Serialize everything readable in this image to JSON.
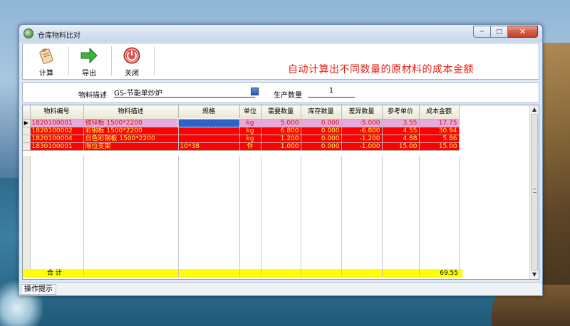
{
  "window": {
    "title": "仓库物料比对"
  },
  "toolbar": {
    "calculate_label": "计算",
    "export_label": "导出",
    "close_label": "关闭",
    "headline": "自动计算出不同数量的原材料的成本金额"
  },
  "form": {
    "material_desc_label": "物料描述",
    "material_desc_value": "GS-节能单炒炉",
    "quantity_label": "生产数量",
    "quantity_value": "1"
  },
  "grid": {
    "columns": [
      "物料编号",
      "物料描述",
      "规格",
      "单位",
      "需要数量",
      "库存数量",
      "差异数量",
      "参考单价",
      "成本金额"
    ],
    "rows": [
      {
        "code": "1820100001",
        "desc": "镀锌板 1500*2200",
        "spec": "",
        "unit": "kg",
        "need": "5.000",
        "stock": "0.000",
        "diff": "-5.000",
        "price": "3.55",
        "amount": "17.75"
      },
      {
        "code": "1820100002",
        "desc": "彩钢板 1500*2200",
        "spec": "",
        "unit": "kg",
        "need": "6.800",
        "stock": "0.000",
        "diff": "-6.800",
        "price": "4.55",
        "amount": "30.94"
      },
      {
        "code": "1820100004",
        "desc": "白色彩钢板 1500*2200",
        "spec": "",
        "unit": "kg",
        "need": "1.200",
        "stock": "0.000",
        "diff": "-1.200",
        "price": "4.88",
        "amount": "5.86"
      },
      {
        "code": "1830100001",
        "desc": "限位支架",
        "spec": "10*38",
        "unit": "件",
        "need": "1.000",
        "stock": "0.000",
        "diff": "-1.000",
        "price": "15.00",
        "amount": "15.00"
      }
    ],
    "total_label": "合 计",
    "total_amount": "69.55"
  },
  "status": {
    "hint": "操作提示"
  },
  "colors": {
    "selected_row": "#e9a9dc",
    "shortage_row": "#ff0000",
    "total_row": "#ffff00",
    "headline": "#e2231a"
  }
}
